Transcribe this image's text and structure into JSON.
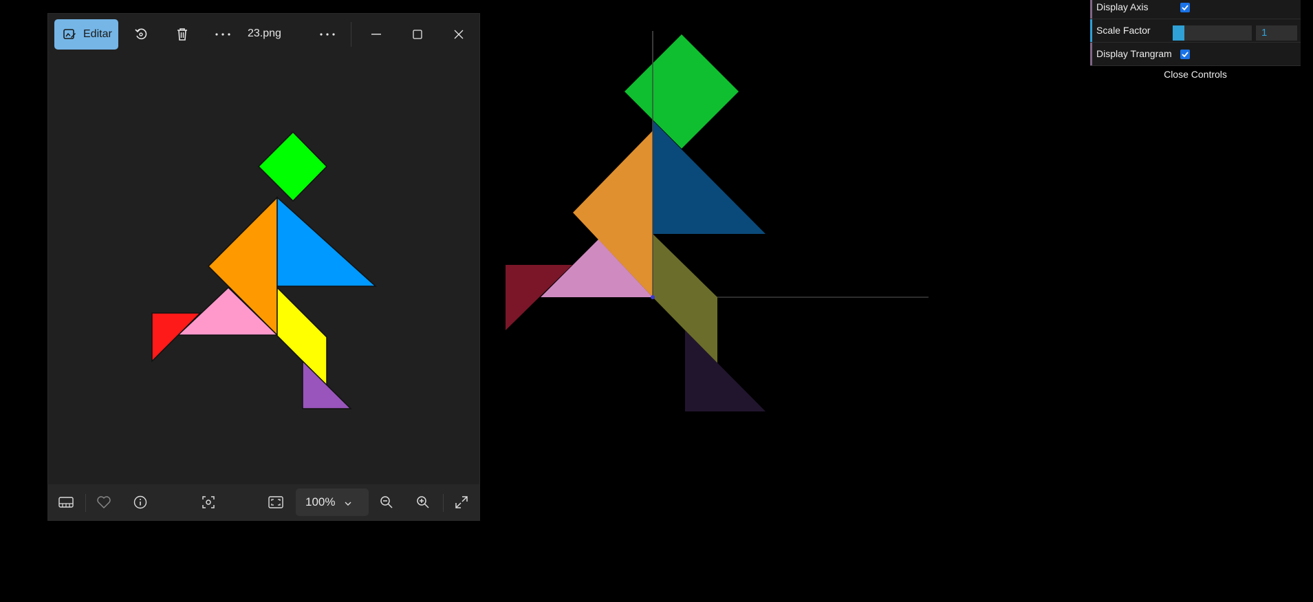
{
  "viewer": {
    "edit_label": "Editar",
    "filename": "23.png",
    "zoom_level": "100%"
  },
  "controls": {
    "display_axis_label": "Display Axis",
    "display_axis_checked": true,
    "scale_factor_label": "Scale Factor",
    "scale_factor_value": "1",
    "scale_factor_fraction": 0.15,
    "display_tangram_label": "Display Trangram",
    "display_tangram_checked": true,
    "close_label": "Close Controls",
    "stripe_colors": [
      "#806787",
      "#2fa1d6",
      "#806787"
    ]
  },
  "icons": [
    "edit-image-icon",
    "rotate-icon",
    "trash-icon",
    "more-icon",
    "minimize-icon",
    "maximize-icon",
    "close-icon",
    "filmstrip-icon",
    "heart-icon",
    "info-icon",
    "scan-icon",
    "fit-icon",
    "chevron-down-icon",
    "zoom-out-icon",
    "zoom-in-icon",
    "fullscreen-icon"
  ],
  "colors": {
    "image_square": "#00ff00",
    "image_orange": "#ff9900",
    "image_blue": "#0099ff",
    "image_pink": "#ff99cc",
    "image_red": "#ff1a1a",
    "image_yellow": "#ffff00",
    "image_purple": "#9955bb",
    "scene_square": "#0fbf2f",
    "scene_orange": "#e0902e",
    "scene_blue": "#0a4a7a",
    "scene_pink": "#cf8ac0",
    "scene_red": "#7a1628",
    "scene_olive": "#6b6e2a",
    "scene_purple": "#21152e"
  }
}
